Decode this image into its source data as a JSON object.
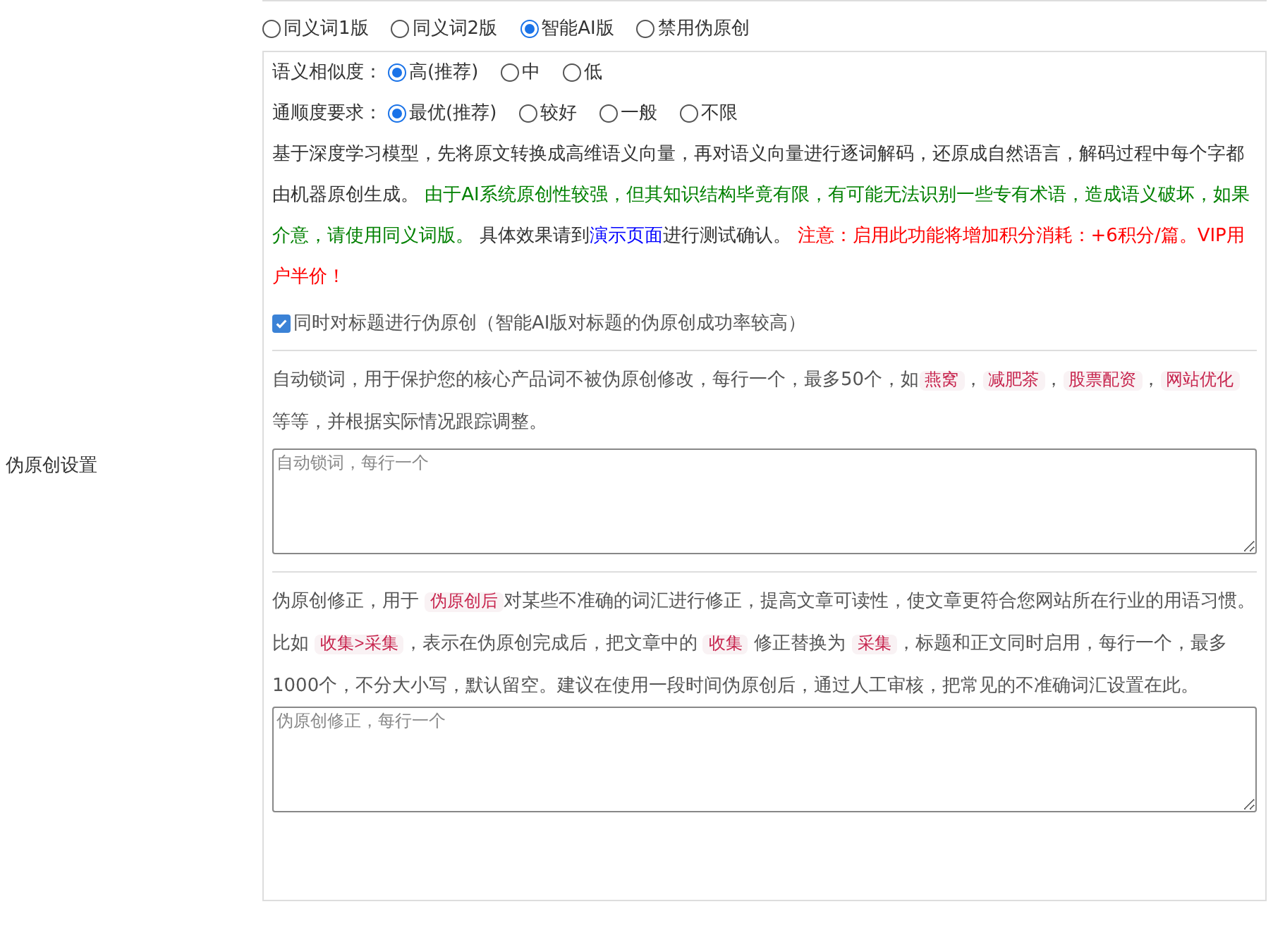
{
  "section_label": "伪原创设置",
  "modes": [
    {
      "label": "同义词1版",
      "selected": false
    },
    {
      "label": "同义词2版",
      "selected": false
    },
    {
      "label": "智能AI版",
      "selected": true
    },
    {
      "label": "禁用伪原创",
      "selected": false
    }
  ],
  "option_groups": [
    {
      "label": "语义相似度：",
      "options": [
        {
          "label": "高(推荐)",
          "selected": true
        },
        {
          "label": "中",
          "selected": false
        },
        {
          "label": "低",
          "selected": false
        }
      ]
    },
    {
      "label": "通顺度要求：",
      "options": [
        {
          "label": "最优(推荐)",
          "selected": true
        },
        {
          "label": "较好",
          "selected": false
        },
        {
          "label": "一般",
          "selected": false
        },
        {
          "label": "不限",
          "selected": false
        }
      ]
    }
  ],
  "description": [
    {
      "kind": "plain",
      "text": "基于深度学习模型，先将原文转换成高维语义向量，再对语义向量进行逐词解码，还原成自然语言，解码过程中每个字都由机器原创生成。 "
    },
    {
      "kind": "green",
      "text": "由于AI系统原创性较强，但其知识结构毕竟有限，有可能无法识别一些专有术语，造成语义破坏，如果介意，请使用同义词版。"
    },
    {
      "kind": "plain",
      "text": " 具体效果请到"
    },
    {
      "kind": "link",
      "text": "演示页面"
    },
    {
      "kind": "plain",
      "text": "进行测试确认。 "
    },
    {
      "kind": "red",
      "text": "注意：启用此功能将增加积分消耗：+6积分/篇。VIP用户半价！"
    }
  ],
  "title_option": {
    "label": "同时对标题进行伪原创（智能AI版对标题的伪原创成功率较高）",
    "checked": true
  },
  "lock_words": {
    "description": [
      {
        "kind": "plain",
        "text": "自动锁词，用于保护您的核心产品词不被伪原创修改，每行一个，最多50个，如"
      },
      {
        "kind": "tag",
        "text": "燕窝"
      },
      {
        "kind": "plain",
        "text": "，"
      },
      {
        "kind": "tag",
        "text": "减肥茶"
      },
      {
        "kind": "plain",
        "text": "，"
      },
      {
        "kind": "tag",
        "text": "股票配资"
      },
      {
        "kind": "plain",
        "text": "，"
      },
      {
        "kind": "tag",
        "text": "网站优化"
      },
      {
        "kind": "plain",
        "text": " 等等，并根据实际情况跟踪调整。"
      }
    ],
    "placeholder": "自动锁词，每行一个"
  },
  "corrections": {
    "description": [
      {
        "kind": "plain",
        "text": "伪原创修正，用于 "
      },
      {
        "kind": "tag",
        "text": "伪原创后"
      },
      {
        "kind": "plain",
        "text": "对某些不准确的词汇进行修正，提高文章可读性，使文章更符合您网站所在行业的用语习惯。比如 "
      },
      {
        "kind": "tag",
        "text": "收集>采集"
      },
      {
        "kind": "plain",
        "text": "，表示在伪原创完成后，把文章中的 "
      },
      {
        "kind": "tag",
        "text": "收集"
      },
      {
        "kind": "plain",
        "text": " 修正替换为 "
      },
      {
        "kind": "tag",
        "text": "采集"
      },
      {
        "kind": "plain",
        "text": "，标题和正文同时启用，每行一个，最多1000个，不分大小写，默认留空。建议在使用一段时间伪原创后，通过人工审核，把常见的不准确词汇设置在此。"
      }
    ],
    "placeholder": "伪原创修正，每行一个"
  }
}
